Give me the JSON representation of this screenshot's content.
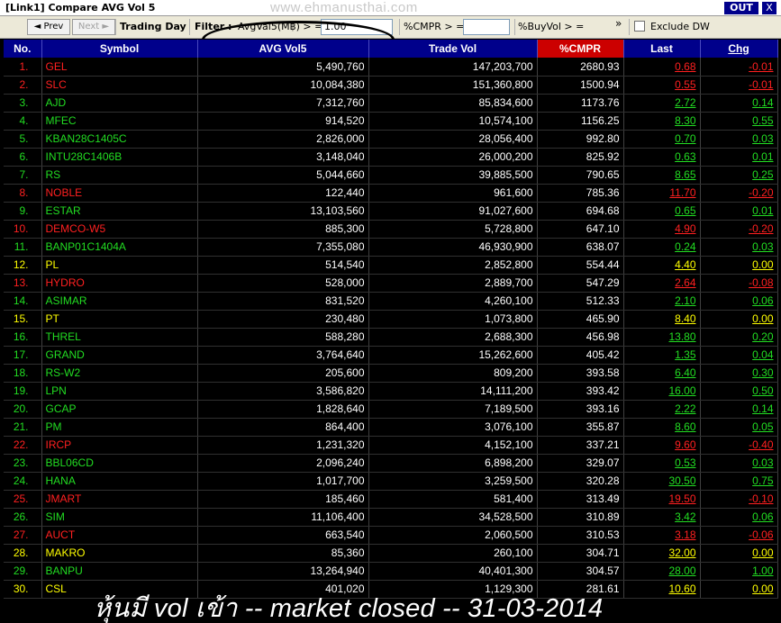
{
  "window": {
    "title": "[Link1] Compare AVG Vol 5",
    "watermark": "www.ehmanusthai.com",
    "out_label": "OUT",
    "close_label": "X"
  },
  "toolbar": {
    "prev_label": "◄ Prev",
    "next_label": "Next ►",
    "trading_day_label": "Trading Day",
    "filter_label": "Filter :",
    "avgval_label": "AvgVal5(M฿) > =",
    "avgval_value": "1.00",
    "cmpr_label": "%CMPR > =",
    "cmpr_value": "",
    "buyvol_label": "%BuyVol > =",
    "more_label": "»",
    "exclude_dw_label": "Exclude DW",
    "exclude_dw_checked": false
  },
  "table": {
    "headers": {
      "no": "No.",
      "symbol": "Symbol",
      "avgvol": "AVG Vol5",
      "tradevol": "Trade Vol",
      "cmpr": "%CMPR",
      "last": "Last",
      "chg": "Chg"
    },
    "colors": {
      "up": "#22dd22",
      "down": "#ff2020",
      "unchanged": "#ffff00",
      "header_bg": "#00008b",
      "highlight_header_bg": "#cc0000"
    },
    "rows": [
      {
        "no": "1.",
        "symbol": "GEL",
        "avgvol": "5,490,760",
        "tradevol": "147,203,700",
        "cmpr": "2680.93",
        "last": "0.68",
        "chg": "-0.01",
        "dir": "down"
      },
      {
        "no": "2.",
        "symbol": "SLC",
        "avgvol": "10,084,380",
        "tradevol": "151,360,800",
        "cmpr": "1500.94",
        "last": "0.55",
        "chg": "-0.01",
        "dir": "down"
      },
      {
        "no": "3.",
        "symbol": "AJD",
        "avgvol": "7,312,760",
        "tradevol": "85,834,600",
        "cmpr": "1173.76",
        "last": "2.72",
        "chg": "0.14",
        "dir": "up"
      },
      {
        "no": "4.",
        "symbol": "MFEC",
        "avgvol": "914,520",
        "tradevol": "10,574,100",
        "cmpr": "1156.25",
        "last": "8.30",
        "chg": "0.55",
        "dir": "up"
      },
      {
        "no": "5.",
        "symbol": "KBAN28C1405C",
        "avgvol": "2,826,000",
        "tradevol": "28,056,400",
        "cmpr": "992.80",
        "last": "0.70",
        "chg": "0.03",
        "dir": "up"
      },
      {
        "no": "6.",
        "symbol": "INTU28C1406B",
        "avgvol": "3,148,040",
        "tradevol": "26,000,200",
        "cmpr": "825.92",
        "last": "0.63",
        "chg": "0.01",
        "dir": "up"
      },
      {
        "no": "7.",
        "symbol": "RS",
        "avgvol": "5,044,660",
        "tradevol": "39,885,500",
        "cmpr": "790.65",
        "last": "8.65",
        "chg": "0.25",
        "dir": "up"
      },
      {
        "no": "8.",
        "symbol": "NOBLE",
        "avgvol": "122,440",
        "tradevol": "961,600",
        "cmpr": "785.36",
        "last": "11.70",
        "chg": "-0.20",
        "dir": "down"
      },
      {
        "no": "9.",
        "symbol": "ESTAR",
        "avgvol": "13,103,560",
        "tradevol": "91,027,600",
        "cmpr": "694.68",
        "last": "0.65",
        "chg": "0.01",
        "dir": "up"
      },
      {
        "no": "10.",
        "symbol": "DEMCO-W5",
        "avgvol": "885,300",
        "tradevol": "5,728,800",
        "cmpr": "647.10",
        "last": "4.90",
        "chg": "-0.20",
        "dir": "down"
      },
      {
        "no": "11.",
        "symbol": "BANP01C1404A",
        "avgvol": "7,355,080",
        "tradevol": "46,930,900",
        "cmpr": "638.07",
        "last": "0.24",
        "chg": "0.03",
        "dir": "up"
      },
      {
        "no": "12.",
        "symbol": "PL",
        "avgvol": "514,540",
        "tradevol": "2,852,800",
        "cmpr": "554.44",
        "last": "4.40",
        "chg": "0.00",
        "dir": "unchanged"
      },
      {
        "no": "13.",
        "symbol": "HYDRO",
        "avgvol": "528,000",
        "tradevol": "2,889,700",
        "cmpr": "547.29",
        "last": "2.64",
        "chg": "-0.08",
        "dir": "down"
      },
      {
        "no": "14.",
        "symbol": "ASIMAR",
        "avgvol": "831,520",
        "tradevol": "4,260,100",
        "cmpr": "512.33",
        "last": "2.10",
        "chg": "0.06",
        "dir": "up"
      },
      {
        "no": "15.",
        "symbol": "PT",
        "avgvol": "230,480",
        "tradevol": "1,073,800",
        "cmpr": "465.90",
        "last": "8.40",
        "chg": "0.00",
        "dir": "unchanged"
      },
      {
        "no": "16.",
        "symbol": "THREL",
        "avgvol": "588,280",
        "tradevol": "2,688,300",
        "cmpr": "456.98",
        "last": "13.80",
        "chg": "0.20",
        "dir": "up"
      },
      {
        "no": "17.",
        "symbol": "GRAND",
        "avgvol": "3,764,640",
        "tradevol": "15,262,600",
        "cmpr": "405.42",
        "last": "1.35",
        "chg": "0.04",
        "dir": "up"
      },
      {
        "no": "18.",
        "symbol": "RS-W2",
        "avgvol": "205,600",
        "tradevol": "809,200",
        "cmpr": "393.58",
        "last": "6.40",
        "chg": "0.30",
        "dir": "up"
      },
      {
        "no": "19.",
        "symbol": "LPN",
        "avgvol": "3,586,820",
        "tradevol": "14,111,200",
        "cmpr": "393.42",
        "last": "16.00",
        "chg": "0.50",
        "dir": "up"
      },
      {
        "no": "20.",
        "symbol": "GCAP",
        "avgvol": "1,828,640",
        "tradevol": "7,189,500",
        "cmpr": "393.16",
        "last": "2.22",
        "chg": "0.14",
        "dir": "up"
      },
      {
        "no": "21.",
        "symbol": "PM",
        "avgvol": "864,400",
        "tradevol": "3,076,100",
        "cmpr": "355.87",
        "last": "8.60",
        "chg": "0.05",
        "dir": "up"
      },
      {
        "no": "22.",
        "symbol": "IRCP",
        "avgvol": "1,231,320",
        "tradevol": "4,152,100",
        "cmpr": "337.21",
        "last": "9.60",
        "chg": "-0.40",
        "dir": "down"
      },
      {
        "no": "23.",
        "symbol": "BBL06CD",
        "avgvol": "2,096,240",
        "tradevol": "6,898,200",
        "cmpr": "329.07",
        "last": "0.53",
        "chg": "0.03",
        "dir": "up"
      },
      {
        "no": "24.",
        "symbol": "HANA",
        "avgvol": "1,017,700",
        "tradevol": "3,259,500",
        "cmpr": "320.28",
        "last": "30.50",
        "chg": "0.75",
        "dir": "up"
      },
      {
        "no": "25.",
        "symbol": "JMART",
        "avgvol": "185,460",
        "tradevol": "581,400",
        "cmpr": "313.49",
        "last": "19.50",
        "chg": "-0.10",
        "dir": "down"
      },
      {
        "no": "26.",
        "symbol": "SIM",
        "avgvol": "11,106,400",
        "tradevol": "34,528,500",
        "cmpr": "310.89",
        "last": "3.42",
        "chg": "0.06",
        "dir": "up"
      },
      {
        "no": "27.",
        "symbol": "AUCT",
        "avgvol": "663,540",
        "tradevol": "2,060,500",
        "cmpr": "310.53",
        "last": "3.18",
        "chg": "-0.06",
        "dir": "down"
      },
      {
        "no": "28.",
        "symbol": "MAKRO",
        "avgvol": "85,360",
        "tradevol": "260,100",
        "cmpr": "304.71",
        "last": "32.00",
        "chg": "0.00",
        "dir": "unchanged"
      },
      {
        "no": "29.",
        "symbol": "BANPU",
        "avgvol": "13,264,940",
        "tradevol": "40,401,300",
        "cmpr": "304.57",
        "last": "28.00",
        "chg": "1.00",
        "dir": "up"
      },
      {
        "no": "30.",
        "symbol": "CSL",
        "avgvol": "401,020",
        "tradevol": "1,129,300",
        "cmpr": "281.61",
        "last": "10.60",
        "chg": "0.00",
        "dir": "unchanged"
      }
    ]
  },
  "caption": "หุ้นมี vol เข้า -- market closed -- 31-03-2014"
}
